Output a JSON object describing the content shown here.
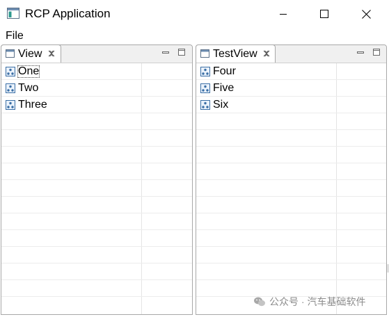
{
  "window": {
    "title": "RCP Application"
  },
  "menubar": {
    "items": [
      "File"
    ]
  },
  "views": [
    {
      "tab_label": "View",
      "items": [
        "One",
        "Two",
        "Three"
      ]
    },
    {
      "tab_label": "TestView",
      "items": [
        "Four",
        "Five",
        "Six"
      ]
    }
  ],
  "watermark": {
    "text": "公众号 · 汽车基础软件"
  },
  "colors": {
    "border": "#a8a8a8",
    "header_bg": "#f0f0f0",
    "icon_blue": "#3a6ea5",
    "row_line": "#ececec"
  }
}
